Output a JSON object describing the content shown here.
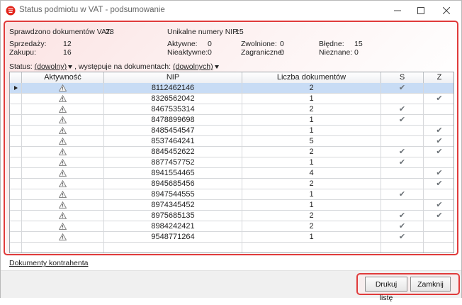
{
  "window": {
    "title": "Status podmiotu w VAT - podsumowanie"
  },
  "summary": {
    "checked_label": "Sprawdzono dokumentów VAT:",
    "checked_value": "28",
    "unique_label": "Unikalne numery NIP:",
    "unique_value": "15",
    "sales_label": "Sprzedaży:",
    "sales_value": "12",
    "purchases_label": "Zakupu:",
    "purchases_value": "16",
    "active_label": "Aktywne:",
    "active_value": "0",
    "inactive_label": "Nieaktywne:",
    "inactive_value": "0",
    "exempt_label": "Zwolnione:",
    "exempt_value": "0",
    "foreign_label": "Zagraniczne:",
    "foreign_value": "0",
    "errors_label": "Błędne:",
    "errors_value": "15",
    "unknown_label": "Nieznane:",
    "unknown_value": "0"
  },
  "filter": {
    "status_label": "Status:",
    "status_value": "(dowolny)",
    "doc_label": ", występuje na dokumentach:",
    "doc_value": "(dowolnych)"
  },
  "table": {
    "columns": [
      "Aktywność",
      "NIP",
      "Liczba dokumentów",
      "S",
      "Z"
    ],
    "rows": [
      {
        "nip": "8112462146",
        "count": "2",
        "s": true,
        "z": false
      },
      {
        "nip": "8326562042",
        "count": "1",
        "s": false,
        "z": true
      },
      {
        "nip": "8467535314",
        "count": "2",
        "s": true,
        "z": false
      },
      {
        "nip": "8478899698",
        "count": "1",
        "s": true,
        "z": false
      },
      {
        "nip": "8485454547",
        "count": "1",
        "s": false,
        "z": true
      },
      {
        "nip": "8537464241",
        "count": "5",
        "s": false,
        "z": true
      },
      {
        "nip": "8845452622",
        "count": "2",
        "s": true,
        "z": true
      },
      {
        "nip": "8877457752",
        "count": "1",
        "s": true,
        "z": false
      },
      {
        "nip": "8941554465",
        "count": "4",
        "s": false,
        "z": true
      },
      {
        "nip": "8945685456",
        "count": "2",
        "s": false,
        "z": true
      },
      {
        "nip": "8947544555",
        "count": "1",
        "s": true,
        "z": false
      },
      {
        "nip": "8974345452",
        "count": "1",
        "s": false,
        "z": true
      },
      {
        "nip": "8975685135",
        "count": "2",
        "s": true,
        "z": true
      },
      {
        "nip": "8984242421",
        "count": "2",
        "s": true,
        "z": false
      },
      {
        "nip": "9548771264",
        "count": "1",
        "s": true,
        "z": false
      }
    ]
  },
  "links": {
    "contractor_docs": "Dokumenty kontrahenta"
  },
  "buttons": {
    "print": "Drukuj listę",
    "close": "Zamknij"
  },
  "icons": {
    "app": "app-logo-icon",
    "status": "warning-triangle-icon",
    "checked": "checkmark-icon",
    "row_pointer": "row-pointer-icon"
  },
  "colors": {
    "highlight": "#e03b3b",
    "selected_row": "#c8dcf5"
  }
}
